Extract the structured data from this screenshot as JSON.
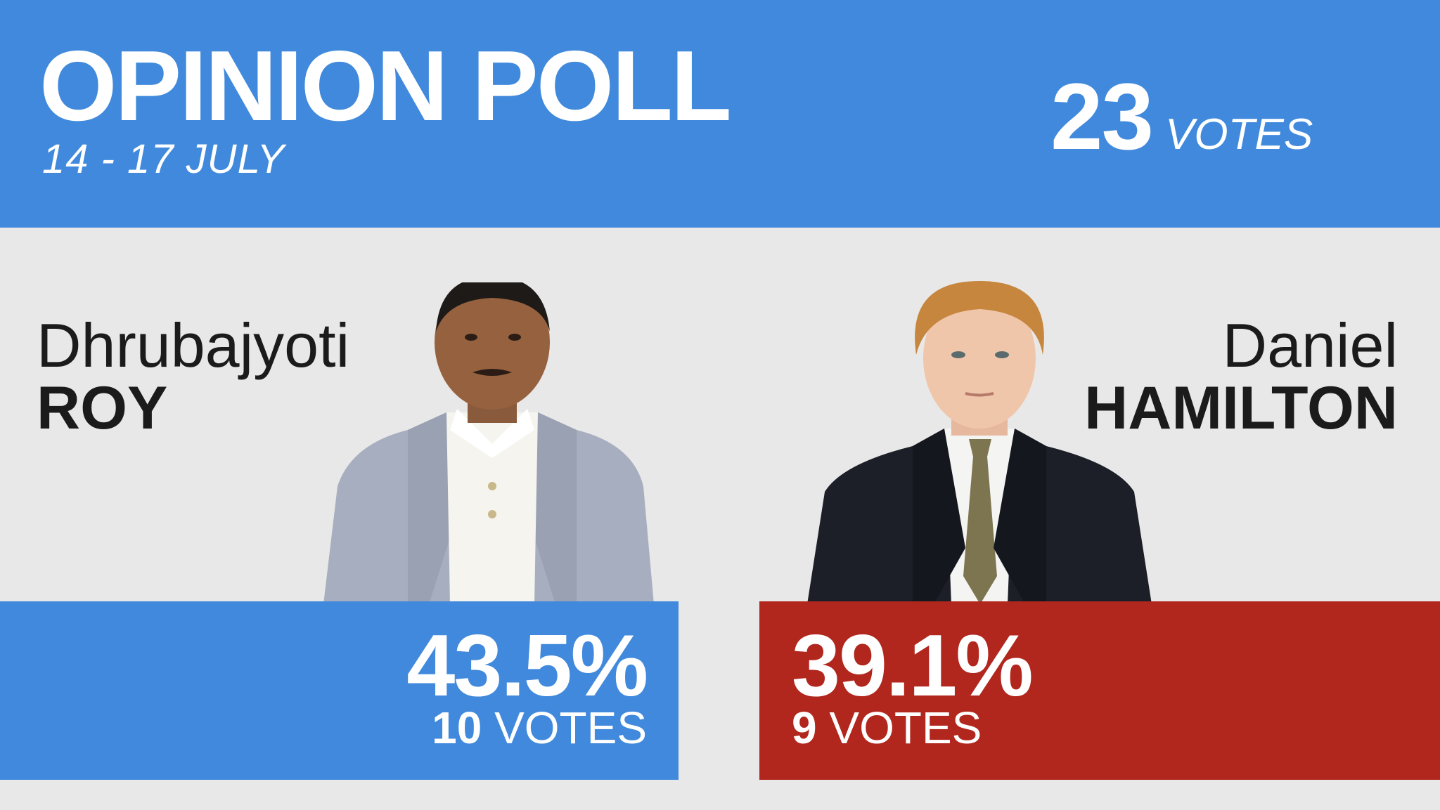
{
  "header": {
    "title": "OPINION POLL",
    "dates": "14 - 17 JULY",
    "total_votes": "23",
    "total_votes_unit": "VOTES"
  },
  "candidates": [
    {
      "first_name": "Dhrubajyoti",
      "last_name": "ROY",
      "percent": "43.5%",
      "votes": "10",
      "votes_unit": "VOTES",
      "color": "#4089dc",
      "photo_icon": "candidate-portrait"
    },
    {
      "first_name": "Daniel",
      "last_name": "HAMILTON",
      "percent": "39.1%",
      "votes": "9",
      "votes_unit": "VOTES",
      "color": "#b1261d",
      "photo_icon": "candidate-portrait"
    }
  ],
  "colors": {
    "header_bg": "#4089dc",
    "page_bg": "#e9e8e8",
    "text_dark": "#1b1b1b"
  }
}
